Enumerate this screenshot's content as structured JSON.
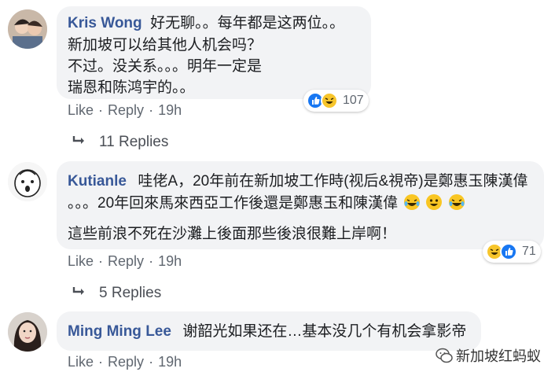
{
  "comments": [
    {
      "author": "Kris Wong",
      "lines": [
        "好无聊。。每年都是这两位。。",
        "新加坡可以给其他人机会吗？",
        "不过。没关系。。。明年一定是",
        "瑞恩和陈鸿宇的。。"
      ],
      "reaction_count": "107",
      "like_label": "Like",
      "reply_label": "Reply",
      "time": "19h",
      "replies_label": "11 Replies"
    },
    {
      "author": "Kutianle",
      "lines": [
        "哇佬A，20年前在新加坡工作時(视后&視帝)是鄭惠玉陳漢偉",
        "。。。20年回來馬來西亞工作後還是鄭惠玉和陳漢偉",
        "這些前浪不死在沙灘上後面那些後浪很難上岸啊！"
      ],
      "reaction_count": "71",
      "like_label": "Like",
      "reply_label": "Reply",
      "time": "19h",
      "replies_label": "5 Replies"
    },
    {
      "author": "Ming Ming Lee",
      "lines": [
        "谢韶光如果还在…基本没几个有机会拿影帝"
      ],
      "like_label": "Like",
      "reply_label": "Reply",
      "time": "19h"
    }
  ],
  "watermark": "新加坡红蚂蚁",
  "colors": {
    "name": "#385898",
    "bubble": "#f2f3f5",
    "like": "#1877f2",
    "haha": "#f7c52b"
  }
}
